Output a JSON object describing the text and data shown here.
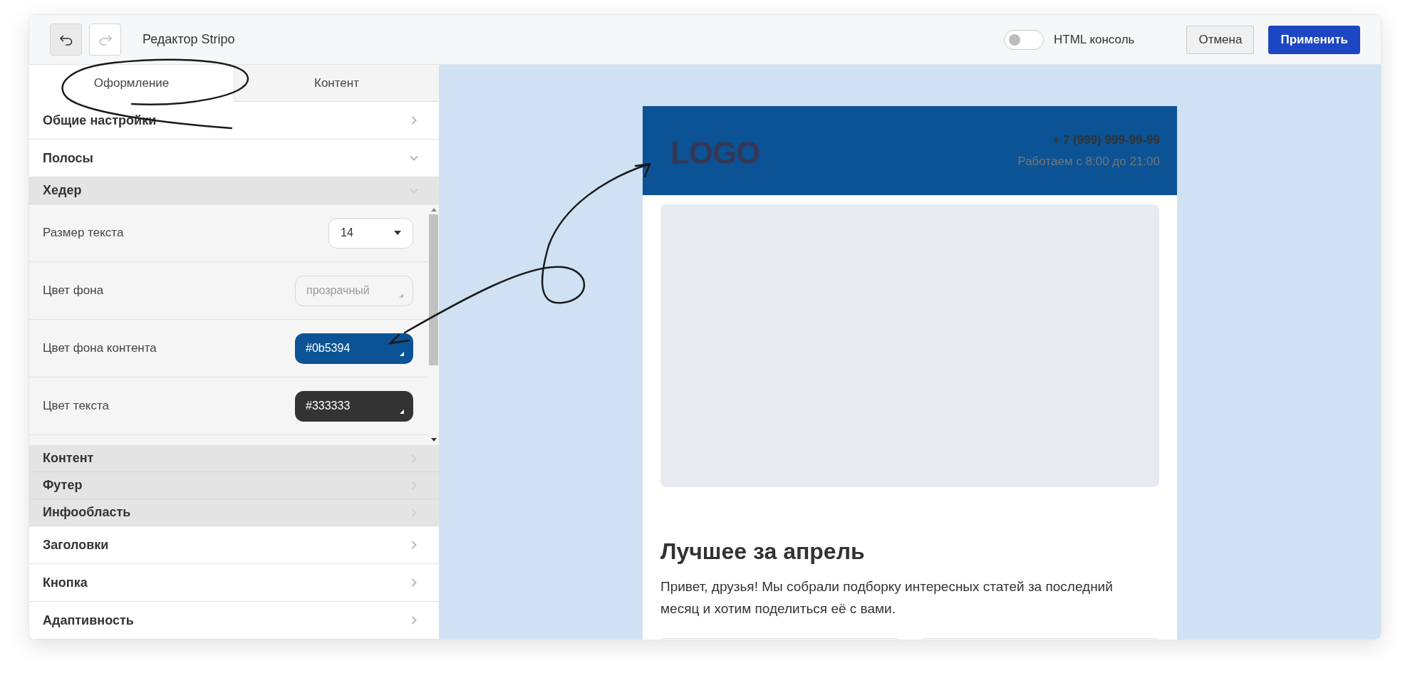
{
  "toolbar": {
    "undo": {
      "disabled": false
    },
    "redo": {
      "disabled": true
    },
    "title": "Редактор Stripo",
    "html_console": {
      "label": "HTML консоль",
      "on": false
    },
    "buttons": [
      {
        "label": "Отмена",
        "kind": "secondary"
      },
      {
        "label": "Применить",
        "kind": "primary"
      }
    ]
  },
  "tabs": [
    {
      "label": "Оформление",
      "selected": true
    },
    {
      "label": "Контент",
      "selected": false
    }
  ],
  "sections": [
    {
      "label": "Общие настройки",
      "expanded": false
    },
    {
      "label": "Полосы",
      "expanded": true,
      "children": [
        {
          "label": "Хедер",
          "expanded": true,
          "settings": [
            {
              "label": "Размер текста",
              "kind": "select",
              "value": "14"
            },
            {
              "label": "Цвет фона",
              "kind": "color",
              "placeholder": "прозрачный"
            },
            {
              "label": "Цвет фона контента",
              "kind": "color",
              "value": "#0b5394",
              "color": "#0b5394"
            },
            {
              "label": "Цвет текста",
              "kind": "color",
              "value": "#333333",
              "color": "#333333"
            }
          ]
        },
        {
          "label": "Контент",
          "expanded": false
        },
        {
          "label": "Футер",
          "expanded": false
        },
        {
          "label": "Инфообласть",
          "expanded": false
        }
      ]
    },
    {
      "label": "Заголовки",
      "expanded": false
    },
    {
      "label": "Кнопка",
      "expanded": false
    },
    {
      "label": "Адаптивность",
      "expanded": false
    }
  ],
  "email": {
    "logo": "LOGO",
    "phone": "+ 7 (999) 999-99-99",
    "hours": "Работаем с 8:00 до 21:00",
    "heading": "Лучшее за апрель",
    "text": "Привет, друзья! Мы собрали подборку интересных статей за последний месяц и хотим поделиться её с вами."
  }
}
